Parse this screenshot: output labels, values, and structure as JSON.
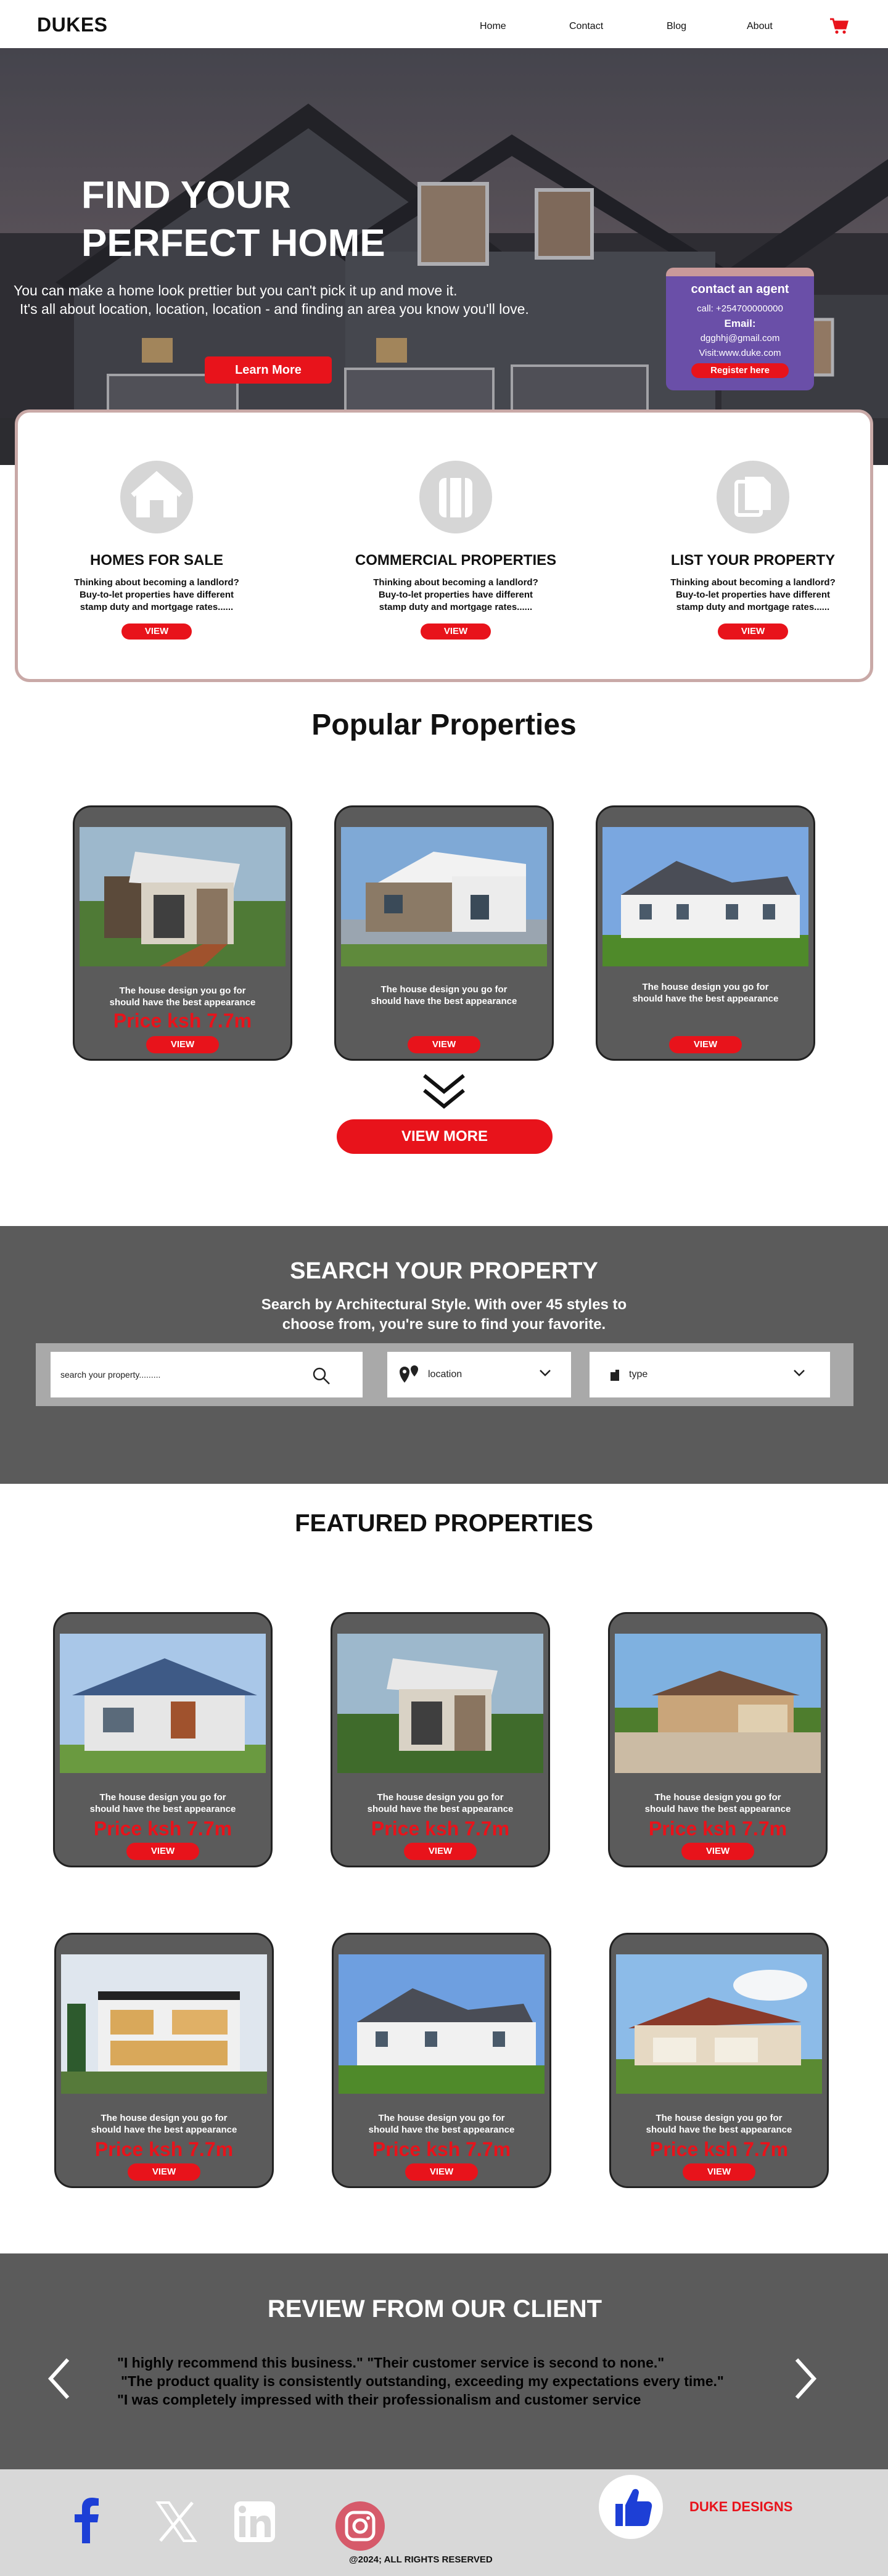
{
  "nav": {
    "logo": "DUKES",
    "links": [
      "Home",
      "Contact",
      "Blog",
      "About"
    ],
    "cart_icon": "cart-icon"
  },
  "hero": {
    "title_line1": "FIND YOUR",
    "title_line2": "PERFECT HOME",
    "subtitle_line1": "You can make a home look prettier but you can't pick it up and move it.",
    "subtitle_line2": "It's all about location, location, location - and finding an area you know you'll love.",
    "cta": "Learn More"
  },
  "agent": {
    "title": "contact an agent",
    "call": "call: +254700000000",
    "email_label": "Email:",
    "email": "dgghhj@gmail.com",
    "visit": "Visit:www.duke.com",
    "register": "Register here"
  },
  "services": [
    {
      "title": "HOMES FOR SALE",
      "desc1": "Thinking about becoming a landlord?",
      "desc2": "Buy-to-let properties have different",
      "desc3": "stamp duty and mortgage rates......",
      "button": "VIEW",
      "icon": "house-icon"
    },
    {
      "title": "COMMERCIAL PROPERTIES",
      "desc1": "Thinking about becoming a landlord?",
      "desc2": "Buy-to-let properties have different",
      "desc3": "stamp duty and mortgage rates......",
      "button": "VIEW",
      "icon": "building-icon"
    },
    {
      "title": "LIST YOUR PROPERTY",
      "desc1": "Thinking about becoming a landlord?",
      "desc2": "Buy-to-let properties have different",
      "desc3": "stamp duty and mortgage rates......",
      "button": "VIEW",
      "icon": "documents-icon"
    }
  ],
  "popular": {
    "heading": "Popular Properties",
    "cards": [
      {
        "cap1": "The house design you go for",
        "cap2": "should have the best appearance",
        "price": "Price ksh  7.7m",
        "button": "VIEW"
      },
      {
        "cap1": "The house design you go for",
        "cap2": "should have the best appearance",
        "price": "",
        "button": "VIEW"
      },
      {
        "cap1": "The house design you go for",
        "cap2": "should have the best appearance",
        "price": "",
        "button": "VIEW"
      }
    ],
    "view_more": "VIEW MORE"
  },
  "search": {
    "heading": "SEARCH YOUR PROPERTY",
    "sub1": "Search by Architectural Style. With over 45 styles to",
    "sub2": "choose from, you're sure to find your favorite.",
    "placeholder": "search your property.........",
    "location": "location",
    "type": "type"
  },
  "featured": {
    "heading": "FEATURED PROPERTIES",
    "cards": [
      {
        "cap1": "The house design you go for",
        "cap2": "should have the best appearance",
        "price": "Price ksh  7.7m",
        "button": "VIEW"
      },
      {
        "cap1": "The house design you go for",
        "cap2": "should have the best appearance",
        "price": "Price ksh  7.7m",
        "button": "VIEW"
      },
      {
        "cap1": "The house design you go for",
        "cap2": "should have the best appearance",
        "price": "Price ksh  7.7m",
        "button": "VIEW"
      },
      {
        "cap1": "The house design you go for",
        "cap2": "should have the best appearance",
        "price": "Price ksh  7.7m",
        "button": "VIEW"
      },
      {
        "cap1": "The house design you go for",
        "cap2": "should have the best appearance",
        "price": "Price ksh  7.7m",
        "button": "VIEW"
      },
      {
        "cap1": "The house design you go for",
        "cap2": "should have the best appearance",
        "price": "Price ksh  7.7m",
        "button": "VIEW"
      }
    ]
  },
  "review": {
    "heading": "REVIEW FROM OUR CLIENT",
    "q1": "\"I highly recommend this business.\" \"Their customer service is second to none.\"",
    "q2": "\"The product quality is consistently outstanding, exceeding my expectations every time.\"",
    "q3": "\"I was completely impressed with their professionalism and customer service"
  },
  "footer": {
    "brand": "DUKE DESIGNS",
    "copyright": "@2024; ALL RIGHTS RESERVED",
    "socials": [
      "facebook-icon",
      "x-icon",
      "linkedin-icon",
      "instagram-icon"
    ]
  },
  "colors": {
    "accent": "#e8131b",
    "panel": "#5b5b5b",
    "agent": "#6a4fa8",
    "facebook": "#1d3fd6"
  }
}
